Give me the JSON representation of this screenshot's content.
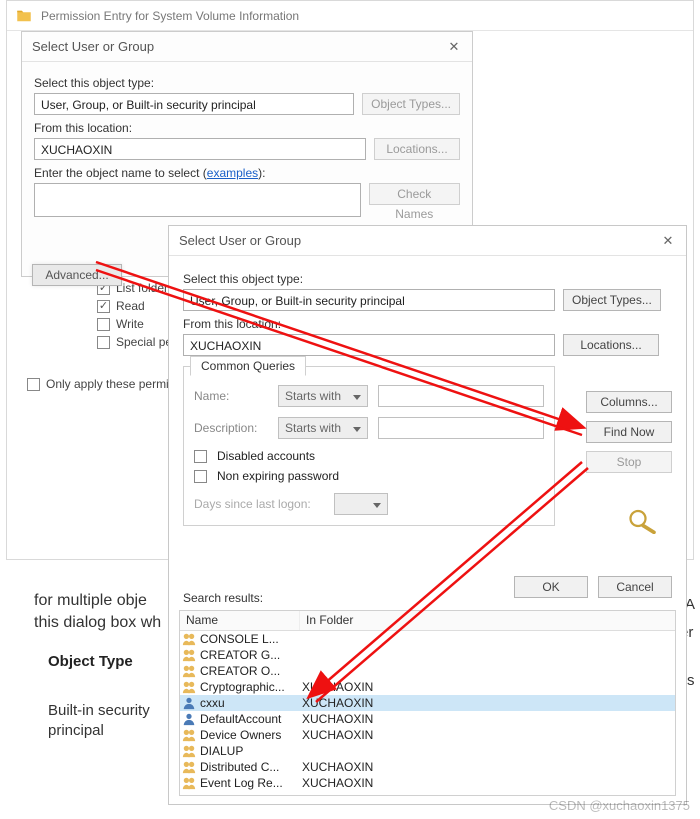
{
  "pe": {
    "title": "Permission Entry for System Volume Information"
  },
  "sug1": {
    "title": "Select User or Group",
    "object_type_label": "Select this object type:",
    "object_type_value": "User, Group, or Built-in security principal",
    "object_types_btn": "Object Types...",
    "location_label": "From this location:",
    "location_value": "XUCHAOXIN",
    "locations_btn": "Locations...",
    "enter_name_label_prefix": "Enter the object name to select (",
    "examples_link": "examples",
    "enter_name_label_suffix": "):",
    "check_names_btn": "Check Names",
    "advanced_btn": "Advanced..."
  },
  "perm": {
    "items": [
      {
        "label": "List folder co",
        "checked": true
      },
      {
        "label": "Read",
        "checked": true
      },
      {
        "label": "Write",
        "checked": false
      },
      {
        "label": "Special perm",
        "checked": false
      }
    ],
    "only_apply": "Only apply these permiss"
  },
  "sug2": {
    "title": "Select User or Group",
    "object_type_label": "Select this object type:",
    "object_type_value": "User, Group, or Built-in security principal",
    "object_types_btn": "Object Types...",
    "location_label": "From this location:",
    "location_value": "XUCHAOXIN",
    "locations_btn": "Locations...",
    "common_queries": "Common Queries",
    "name_label": "Name:",
    "name_mode": "Starts with",
    "desc_label": "Description:",
    "desc_mode": "Starts with",
    "disabled_accounts": "Disabled accounts",
    "non_expiring": "Non expiring password",
    "days_label": "Days since last logon:",
    "columns_btn": "Columns...",
    "find_now_btn": "Find Now",
    "stop_btn": "Stop",
    "ok_btn": "OK",
    "cancel_btn": "Cancel",
    "search_results_label": "Search results:",
    "col_name": "Name",
    "col_folder": "In Folder",
    "rows": [
      {
        "icon": "group",
        "name": "CONSOLE L...",
        "folder": ""
      },
      {
        "icon": "group",
        "name": "CREATOR G...",
        "folder": ""
      },
      {
        "icon": "group",
        "name": "CREATOR O...",
        "folder": ""
      },
      {
        "icon": "group",
        "name": "Cryptographic...",
        "folder": "XUCHAOXIN"
      },
      {
        "icon": "user",
        "name": "cxxu",
        "folder": "XUCHAOXIN",
        "selected": true
      },
      {
        "icon": "user",
        "name": "DefaultAccount",
        "folder": "XUCHAOXIN"
      },
      {
        "icon": "group",
        "name": "Device Owners",
        "folder": "XUCHAOXIN"
      },
      {
        "icon": "group",
        "name": "DIALUP",
        "folder": ""
      },
      {
        "icon": "group",
        "name": "Distributed C...",
        "folder": "XUCHAOXIN"
      },
      {
        "icon": "group",
        "name": "Event Log Re...",
        "folder": "XUCHAOXIN"
      }
    ]
  },
  "bg": {
    "line1": "for multiple obje",
    "line2": "this dialog box wh",
    "heading": "Object Type",
    "val1": "Built-in security",
    "val2": "principal",
    "edge1": "A",
    "edge2": "er",
    "edge3": "rs"
  },
  "watermark": "CSDN @xuchaoxin1375"
}
